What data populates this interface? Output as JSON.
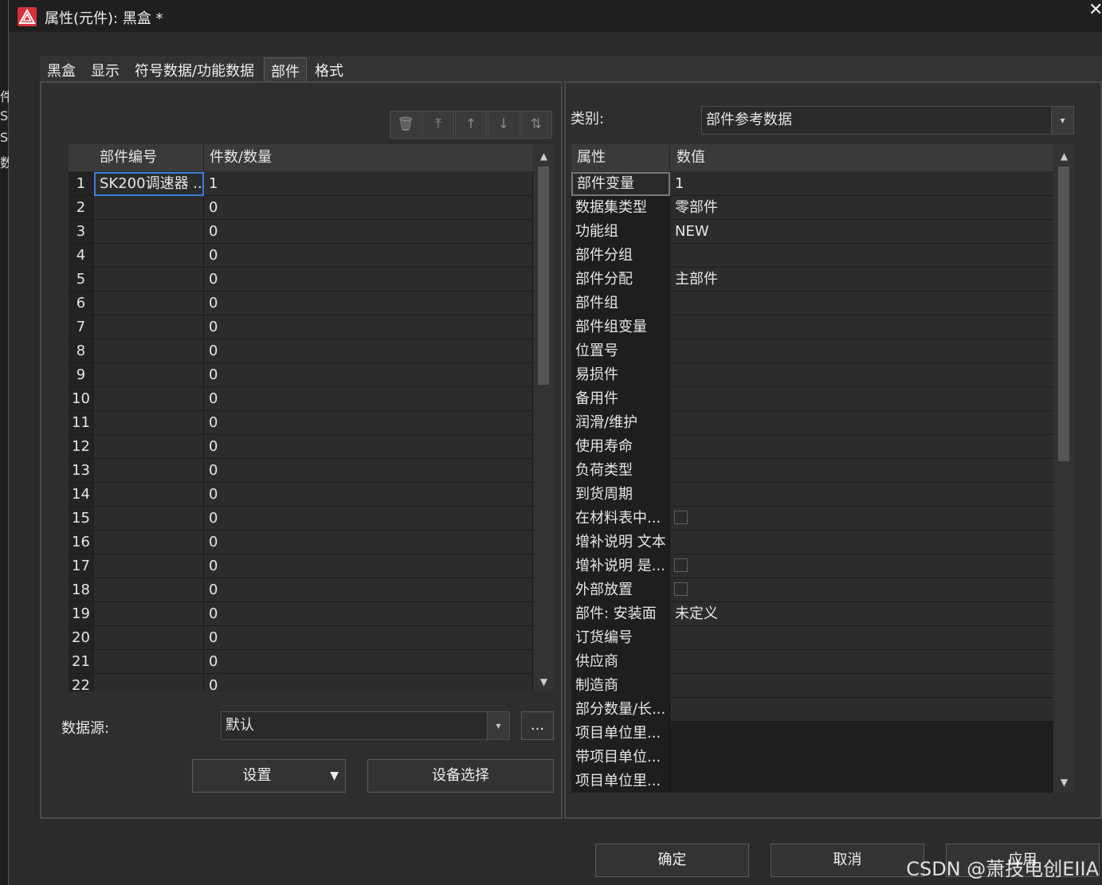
{
  "window": {
    "title": "属性(元件): 黑盒 *",
    "left_edge_chars": [
      "件",
      "SO",
      "SO",
      "数"
    ]
  },
  "tabs": [
    {
      "label": "黑盒",
      "active": false
    },
    {
      "label": "显示",
      "active": false
    },
    {
      "label": "符号数据/功能数据",
      "active": false
    },
    {
      "label": "部件",
      "active": true
    },
    {
      "label": "格式",
      "active": false
    }
  ],
  "toolbar": {
    "icons": [
      "trash-icon",
      "move-top-icon",
      "move-up-icon",
      "move-down-icon",
      "swap-icon"
    ],
    "glyphs": [
      "🗑",
      "⤒",
      "↑",
      "↓",
      "⇅"
    ]
  },
  "parts_grid": {
    "headers": [
      "部件编号",
      "件数/数量"
    ],
    "rows": [
      {
        "num": "1",
        "part": "SK200调速器 ...",
        "qty": "1"
      },
      {
        "num": "2",
        "part": "",
        "qty": "0"
      },
      {
        "num": "3",
        "part": "",
        "qty": "0"
      },
      {
        "num": "4",
        "part": "",
        "qty": "0"
      },
      {
        "num": "5",
        "part": "",
        "qty": "0"
      },
      {
        "num": "6",
        "part": "",
        "qty": "0"
      },
      {
        "num": "7",
        "part": "",
        "qty": "0"
      },
      {
        "num": "8",
        "part": "",
        "qty": "0"
      },
      {
        "num": "9",
        "part": "",
        "qty": "0"
      },
      {
        "num": "10",
        "part": "",
        "qty": "0"
      },
      {
        "num": "11",
        "part": "",
        "qty": "0"
      },
      {
        "num": "12",
        "part": "",
        "qty": "0"
      },
      {
        "num": "13",
        "part": "",
        "qty": "0"
      },
      {
        "num": "14",
        "part": "",
        "qty": "0"
      },
      {
        "num": "15",
        "part": "",
        "qty": "0"
      },
      {
        "num": "16",
        "part": "",
        "qty": "0"
      },
      {
        "num": "17",
        "part": "",
        "qty": "0"
      },
      {
        "num": "18",
        "part": "",
        "qty": "0"
      },
      {
        "num": "19",
        "part": "",
        "qty": "0"
      },
      {
        "num": "20",
        "part": "",
        "qty": "0"
      },
      {
        "num": "21",
        "part": "",
        "qty": "0"
      },
      {
        "num": "22",
        "part": "",
        "qty": "0"
      }
    ]
  },
  "datasource": {
    "label": "数据源:",
    "value": "默认",
    "more_label": "..."
  },
  "buttons": {
    "settings": "设置",
    "device_select": "设备选择",
    "ok": "确定",
    "cancel": "取消",
    "apply": "应用"
  },
  "category": {
    "label": "类别:",
    "value": "部件参考数据"
  },
  "properties": {
    "headers": [
      "属性",
      "数值"
    ],
    "rows": [
      {
        "name": "部件变量",
        "value": "1",
        "type": "text"
      },
      {
        "name": "数据集类型",
        "value": "零部件",
        "type": "text"
      },
      {
        "name": "功能组",
        "value": "NEW",
        "type": "text"
      },
      {
        "name": "部件分组",
        "value": "",
        "type": "text"
      },
      {
        "name": "部件分配",
        "value": "主部件",
        "type": "text"
      },
      {
        "name": "部件组",
        "value": "",
        "type": "text"
      },
      {
        "name": "部件组变量",
        "value": "",
        "type": "text"
      },
      {
        "name": "位置号",
        "value": "",
        "type": "text"
      },
      {
        "name": "易损件",
        "value": "",
        "type": "text"
      },
      {
        "name": "备用件",
        "value": "",
        "type": "text"
      },
      {
        "name": "润滑/维护",
        "value": "",
        "type": "text"
      },
      {
        "name": "使用寿命",
        "value": "",
        "type": "text"
      },
      {
        "name": "负荷类型",
        "value": "",
        "type": "text"
      },
      {
        "name": "到货周期",
        "value": "",
        "type": "text"
      },
      {
        "name": "在材料表中...",
        "value": "",
        "type": "checkbox"
      },
      {
        "name": "增补说明 文本",
        "value": "",
        "type": "text"
      },
      {
        "name": "增补说明 是...",
        "value": "",
        "type": "checkbox"
      },
      {
        "name": "外部放置",
        "value": "",
        "type": "checkbox"
      },
      {
        "name": "部件: 安装面",
        "value": "未定义",
        "type": "text"
      },
      {
        "name": "订货编号",
        "value": "",
        "type": "text"
      },
      {
        "name": "供应商",
        "value": "",
        "type": "text"
      },
      {
        "name": "制造商",
        "value": "",
        "type": "text"
      },
      {
        "name": "部分数量/长...",
        "value": "",
        "type": "text"
      },
      {
        "name": "项目单位里...",
        "value": "",
        "type": "dark"
      },
      {
        "name": "带项目单位...",
        "value": "",
        "type": "dark"
      },
      {
        "name": "项目单位里...",
        "value": "",
        "type": "dark"
      }
    ]
  },
  "watermark": "CSDN @萧技电创EIIA"
}
